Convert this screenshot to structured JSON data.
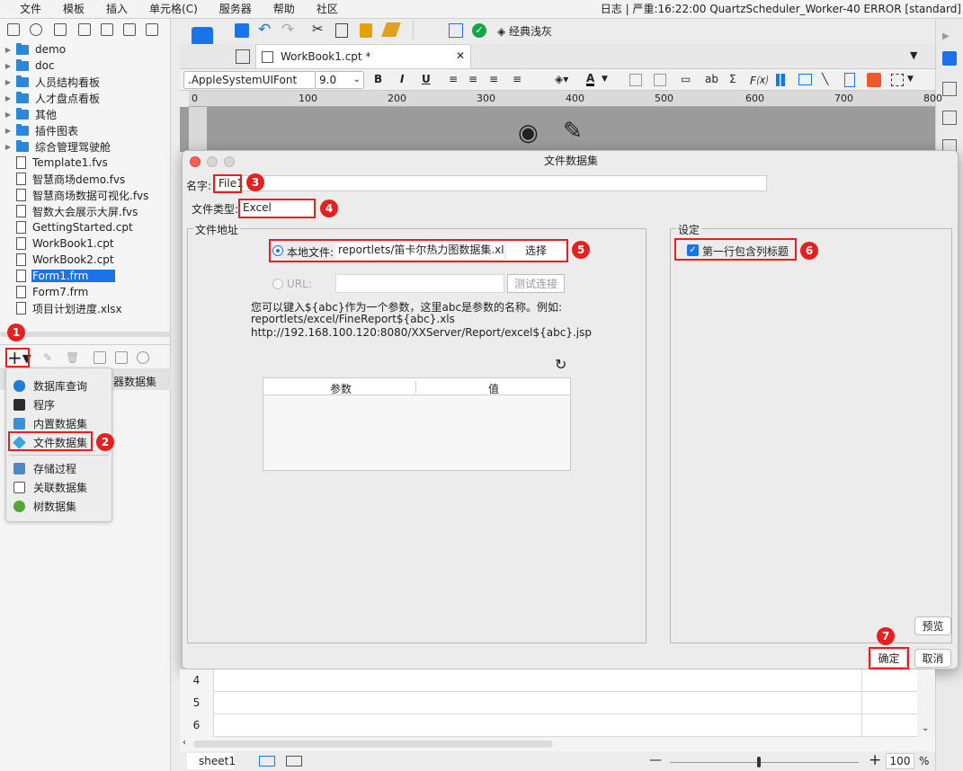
{
  "menubar": {
    "items": [
      "文件",
      "模板",
      "插入",
      "单元格(C)",
      "服务器",
      "帮助",
      "社区"
    ],
    "status": "日志 | 严重:16:22:00 QuartzScheduler_Worker-40 ERROR [standard]"
  },
  "tree": {
    "items": [
      {
        "type": "folder",
        "label": "demo"
      },
      {
        "type": "folder",
        "label": "doc"
      },
      {
        "type": "folder",
        "label": "人员结构看板"
      },
      {
        "type": "folder",
        "label": "人才盘点看板"
      },
      {
        "type": "folder",
        "label": "其他"
      },
      {
        "type": "folder",
        "label": "插件图表"
      },
      {
        "type": "folder",
        "label": "综合管理驾驶舱"
      },
      {
        "type": "file",
        "label": "Template1.fvs"
      },
      {
        "type": "file",
        "label": "智慧商场demo.fvs"
      },
      {
        "type": "file",
        "label": "智慧商场数据可视化.fvs"
      },
      {
        "type": "file",
        "label": "智数大会展示大屏.fvs"
      },
      {
        "type": "file",
        "label": "GettingStarted.cpt"
      },
      {
        "type": "file",
        "label": "WorkBook1.cpt"
      },
      {
        "type": "file",
        "label": "WorkBook2.cpt"
      },
      {
        "type": "file",
        "label": "Form1.frm"
      },
      {
        "type": "file",
        "label": "Form7.frm"
      },
      {
        "type": "file",
        "label": "项目计划进度.xlsx"
      }
    ]
  },
  "dataset_panel": {
    "behind_label": "器数据集"
  },
  "ds_menu": {
    "items": [
      "数据库查询",
      "程序",
      "内置数据集",
      "文件数据集",
      "存储过程",
      "关联数据集",
      "树数据集"
    ]
  },
  "toolbar": {
    "theme_label": "经典浅灰"
  },
  "tab": {
    "label": "WorkBook1.cpt *"
  },
  "format": {
    "font": ".AppleSystemUIFont",
    "size": "9.0"
  },
  "ruler": {
    "labels": [
      "0",
      "100",
      "200",
      "300",
      "400",
      "500",
      "600",
      "700",
      "800"
    ]
  },
  "dialog": {
    "title": "文件数据集",
    "name_label": "名字:",
    "name_value": "File1",
    "type_label": "文件类型:",
    "type_value": "Excel",
    "addr_group": "文件地址",
    "local_label": "本地文件:",
    "local_value": "reportlets/笛卡尔热力图数据集.xls",
    "choose_btn": "选择",
    "url_label": "URL:",
    "test_btn": "测试连接",
    "hint1": "您可以键入${abc}作为一个参数，这里abc是参数的名称。例如:",
    "hint2": "reportlets/excel/FineReport${abc}.xls",
    "hint3": "http://192.168.100.120:8080/XXServer/Report/excel${abc}.jsp",
    "col_param": "参数",
    "col_value": "值",
    "settings_group": "设定",
    "first_row_label": "第一行包含列标题",
    "preview_btn": "预览",
    "ok_btn": "确定",
    "cancel_btn": "取消"
  },
  "badges": [
    "1",
    "2",
    "3",
    "4",
    "5",
    "6",
    "7"
  ],
  "grid": {
    "rows": [
      "4",
      "5",
      "6"
    ]
  },
  "statusbar": {
    "sheet": "sheet1",
    "zoom": "100",
    "percent": "%"
  }
}
